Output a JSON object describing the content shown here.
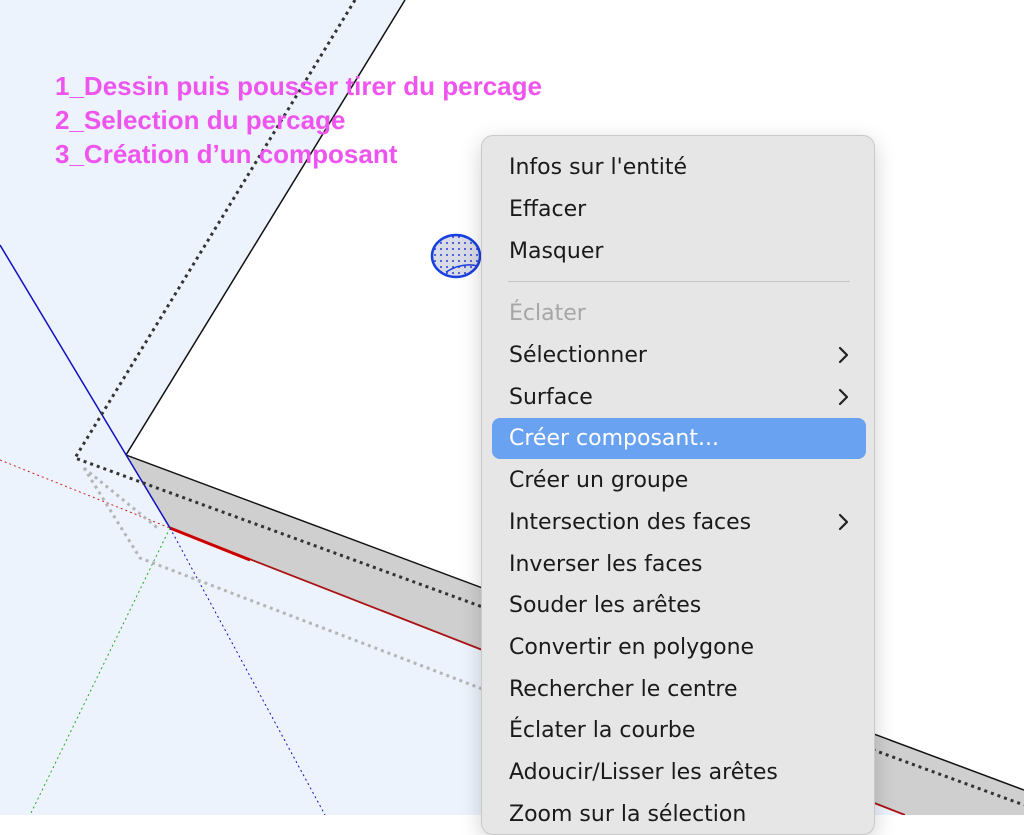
{
  "annotations": [
    "1_Dessin puis pousser tirer du percage",
    "2_Selection du percage",
    "3_Création d’un composant"
  ],
  "colors": {
    "annotation": "#ee55ee",
    "highlight": "#6aa2f2",
    "menu_background": "#e6e6e6",
    "sky": "#edf3fc",
    "axis_red": "#cc0000",
    "axis_green": "#009900",
    "axis_blue": "#0000cc",
    "selection_blue": "#1a3fe0"
  },
  "context_menu": {
    "items": [
      {
        "label": "Infos sur l'entité",
        "state": "normal"
      },
      {
        "label": "Effacer",
        "state": "normal"
      },
      {
        "label": "Masquer",
        "state": "normal"
      },
      {
        "label": "Éclater",
        "state": "disabled"
      },
      {
        "label": "Sélectionner",
        "state": "normal",
        "submenu": true
      },
      {
        "label": "Surface",
        "state": "normal",
        "submenu": true
      },
      {
        "label": "Créer composant...",
        "state": "highlighted"
      },
      {
        "label": "Créer un groupe",
        "state": "normal"
      },
      {
        "label": "Intersection des faces",
        "state": "normal",
        "submenu": true
      },
      {
        "label": "Inverser les faces",
        "state": "normal"
      },
      {
        "label": "Souder les arêtes",
        "state": "normal"
      },
      {
        "label": "Convertir en polygone",
        "state": "normal"
      },
      {
        "label": "Rechercher le centre",
        "state": "normal"
      },
      {
        "label": "Éclater la courbe",
        "state": "normal"
      },
      {
        "label": "Adoucir/Lisser les arêtes",
        "state": "normal"
      },
      {
        "label": "Zoom sur la sélection",
        "state": "normal"
      }
    ]
  }
}
